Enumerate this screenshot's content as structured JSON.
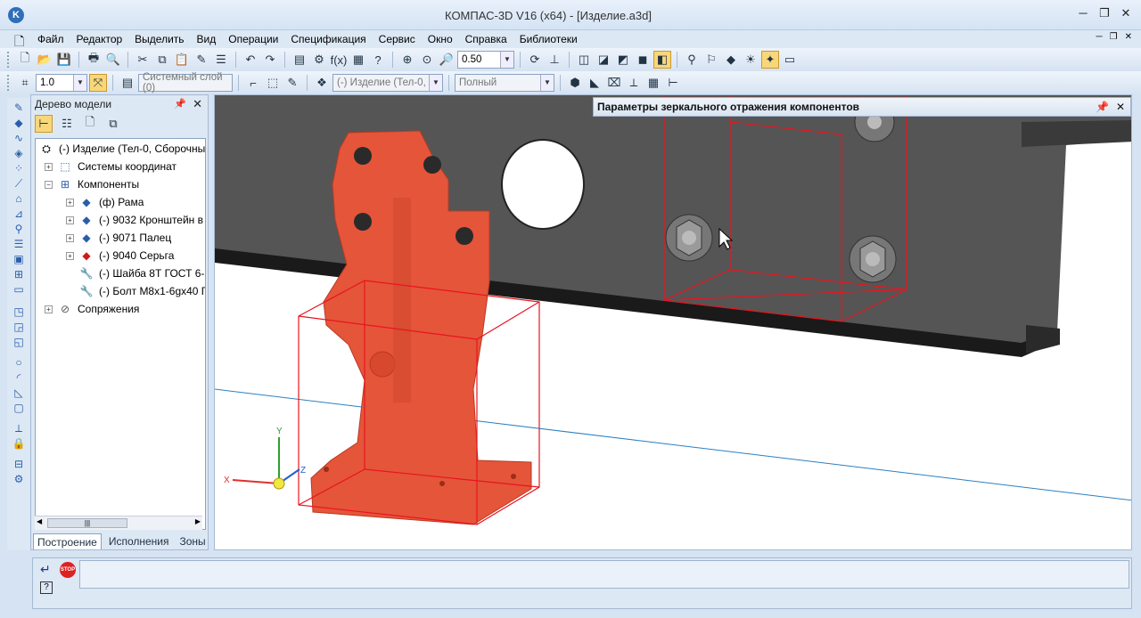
{
  "window": {
    "title": "КОМПАС-3D V16  (x64) - [Изделие.a3d]"
  },
  "menu": [
    "Файл",
    "Редактор",
    "Выделить",
    "Вид",
    "Операции",
    "Спецификация",
    "Сервис",
    "Окно",
    "Справка",
    "Библиотеки"
  ],
  "toolbar1": {
    "zoom_value": "0.50"
  },
  "toolbar2": {
    "step_value": "1.0",
    "layer_value": "Системный слой (0)",
    "part_value": "(-) Изделие (Тел-0,",
    "render_value": "Полный"
  },
  "tree_panel": {
    "title": "Дерево модели",
    "items": [
      {
        "label": "(-) Изделие (Тел-0, Сборочны",
        "level": 0,
        "icon": "assembly-icon"
      },
      {
        "label": "Системы координат",
        "level": 1,
        "icon": "coordinate-system-icon"
      },
      {
        "label": "Компоненты",
        "level": 1,
        "icon": "components-icon"
      },
      {
        "label": "(ф) Рама",
        "level": 2,
        "icon": "part-icon"
      },
      {
        "label": "(-) 9032 Кронштейн в",
        "level": 2,
        "icon": "part-icon"
      },
      {
        "label": "(-) 9071 Палец",
        "level": 2,
        "icon": "part-icon"
      },
      {
        "label": "(-) 9040 Серьга",
        "level": 2,
        "icon": "part-red-icon"
      },
      {
        "label": "(-) Шайба 8Т ГОСТ 6-",
        "level": 2,
        "icon": "standard-part-icon"
      },
      {
        "label": "(-) Болт М8х1-6gх40 Г",
        "level": 2,
        "icon": "standard-part-icon"
      },
      {
        "label": "Сопряжения",
        "level": 1,
        "icon": "mates-icon"
      }
    ],
    "tabs": [
      "Построение",
      "Исполнения",
      "Зоны"
    ]
  },
  "viewport": {
    "panel_title": "Параметры зеркального отражения компонентов",
    "axes": {
      "x": "X",
      "y": "Y",
      "z": "Z"
    }
  },
  "status": {
    "stop_label": "STOP",
    "help_label": "?"
  },
  "colors": {
    "part": "#e5553a",
    "bbox": "#e8141e",
    "frame": "#4a4a4a",
    "panel_bg": "#d6e3f2"
  }
}
